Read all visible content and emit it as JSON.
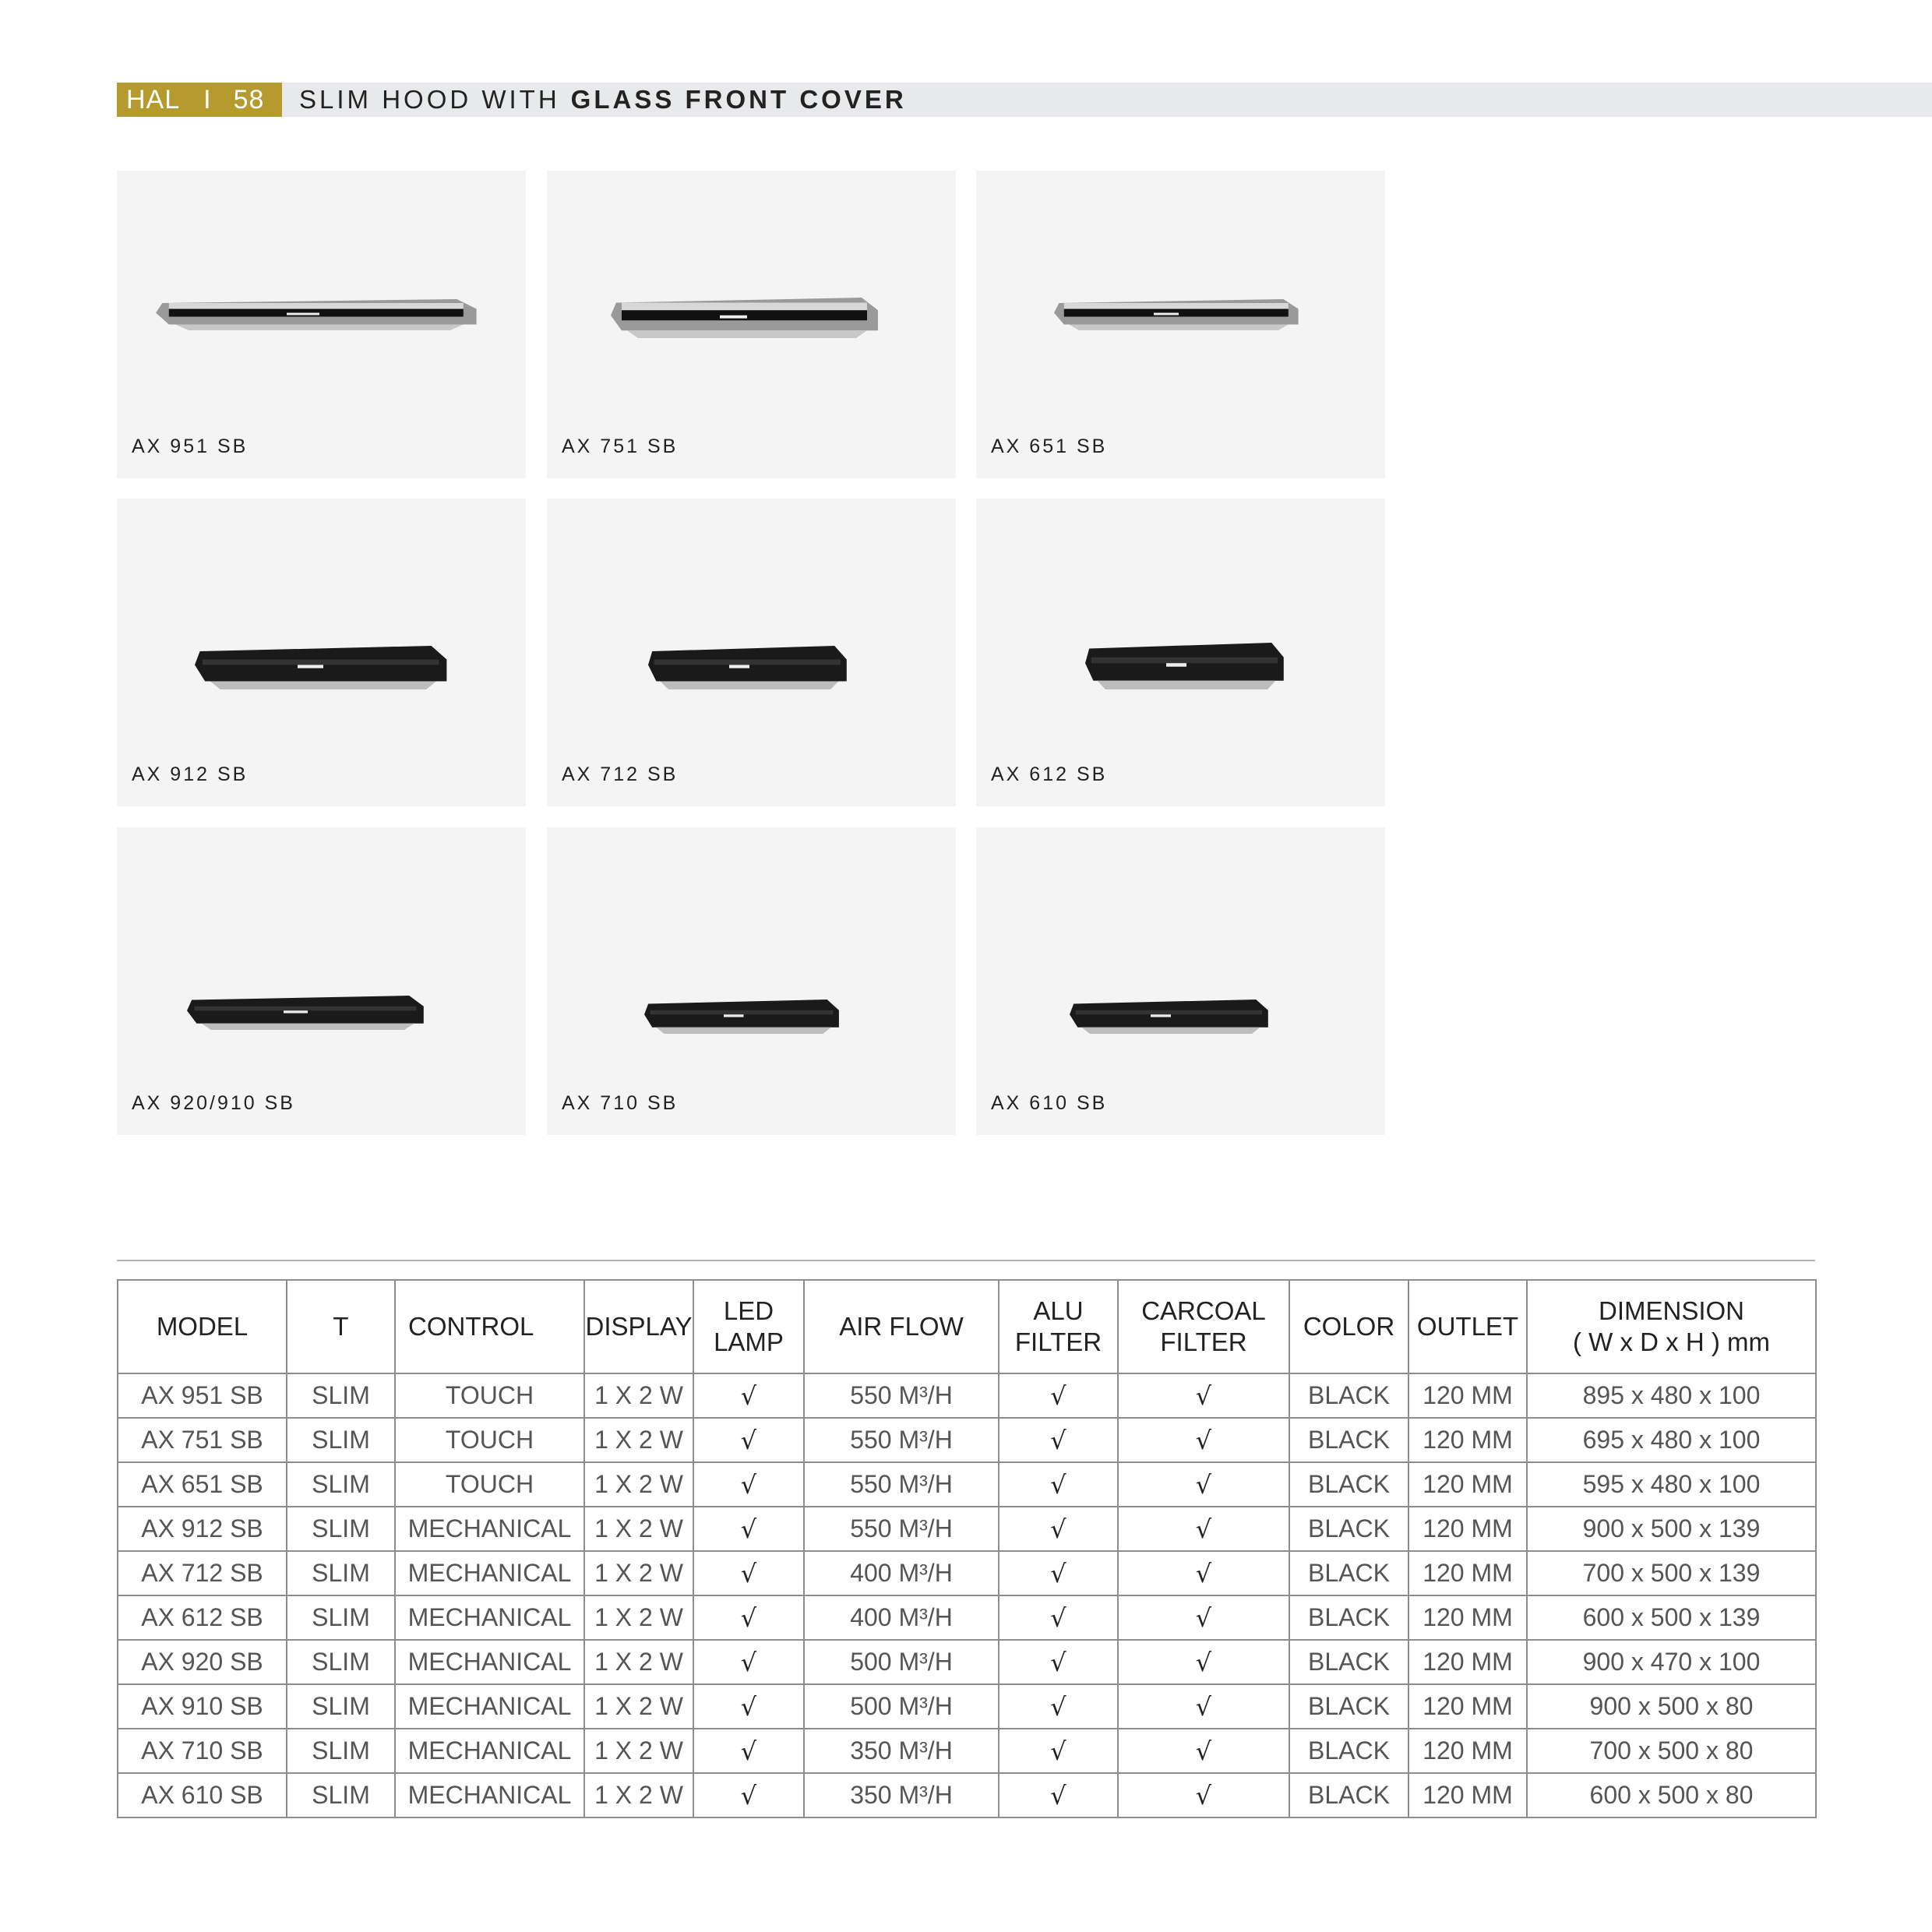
{
  "header": {
    "prefix": "HAL",
    "separator": "I",
    "page_number": "58",
    "title_light": "SLIM HOOD WITH",
    "title_bold": "GLASS FRONT COVER"
  },
  "products": [
    {
      "label": "AX 951 SB",
      "style": "steel"
    },
    {
      "label": "AX 751 SB",
      "style": "steel"
    },
    {
      "label": "AX 651 SB",
      "style": "steel"
    },
    {
      "label": "AX 912 SB",
      "style": "black"
    },
    {
      "label": "AX 712 SB",
      "style": "black"
    },
    {
      "label": "AX 612 SB",
      "style": "black"
    },
    {
      "label": "AX 920/910 SB",
      "style": "black-flat"
    },
    {
      "label": "AX 710 SB",
      "style": "black-flat"
    },
    {
      "label": "AX 610 SB",
      "style": "black-flat"
    }
  ],
  "table": {
    "headers": [
      "MODEL",
      "T",
      "CONTROL",
      "DISPLAY",
      "LED\nLAMP",
      "AIR FLOW",
      "ALU\nFILTER",
      "CARCOAL\nFILTER",
      "COLOR",
      "OUTLET",
      "DIMENSION\n( W x D x H ) mm"
    ],
    "rows": [
      [
        "AX 951 SB",
        "SLIM",
        "TOUCH",
        "1 X 2 W",
        "√",
        "550 M³/H",
        "√",
        "√",
        "BLACK",
        "120 MM",
        "895 x 480 x 100"
      ],
      [
        "AX 751 SB",
        "SLIM",
        "TOUCH",
        "1 X 2 W",
        "√",
        "550 M³/H",
        "√",
        "√",
        "BLACK",
        "120 MM",
        "695 x 480 x 100"
      ],
      [
        "AX 651 SB",
        "SLIM",
        "TOUCH",
        "1 X 2 W",
        "√",
        "550 M³/H",
        "√",
        "√",
        "BLACK",
        "120 MM",
        "595 x 480 x 100"
      ],
      [
        "AX 912 SB",
        "SLIM",
        "MECHANICAL",
        "1 X 2 W",
        "√",
        "550 M³/H",
        "√",
        "√",
        "BLACK",
        "120 MM",
        "900 x 500 x 139"
      ],
      [
        "AX 712 SB",
        "SLIM",
        "MECHANICAL",
        "1 X 2 W",
        "√",
        "400 M³/H",
        "√",
        "√",
        "BLACK",
        "120 MM",
        "700 x 500 x 139"
      ],
      [
        "AX 612 SB",
        "SLIM",
        "MECHANICAL",
        "1 X 2 W",
        "√",
        "400 M³/H",
        "√",
        "√",
        "BLACK",
        "120 MM",
        "600 x 500 x 139"
      ],
      [
        "AX 920 SB",
        "SLIM",
        "MECHANICAL",
        "1 X 2 W",
        "√",
        "500 M³/H",
        "√",
        "√",
        "BLACK",
        "120 MM",
        "900 x 470 x 100"
      ],
      [
        "AX 910 SB",
        "SLIM",
        "MECHANICAL",
        "1 X 2 W",
        "√",
        "500 M³/H",
        "√",
        "√",
        "BLACK",
        "120 MM",
        "900 x 500 x 80"
      ],
      [
        "AX 710 SB",
        "SLIM",
        "MECHANICAL",
        "1 X 2 W",
        "√",
        "350 M³/H",
        "√",
        "√",
        "BLACK",
        "120 MM",
        "700 x 500 x 80"
      ],
      [
        "AX 610 SB",
        "SLIM",
        "MECHANICAL",
        "1 X 2 W",
        "√",
        "350 M³/H",
        "√",
        "√",
        "BLACK",
        "120 MM",
        "600 x 500 x 80"
      ]
    ]
  },
  "colors": {
    "accent_gold": "#b59a2e",
    "band_gray": "#e8e9ea",
    "card_bg": "#f3f4f3"
  }
}
